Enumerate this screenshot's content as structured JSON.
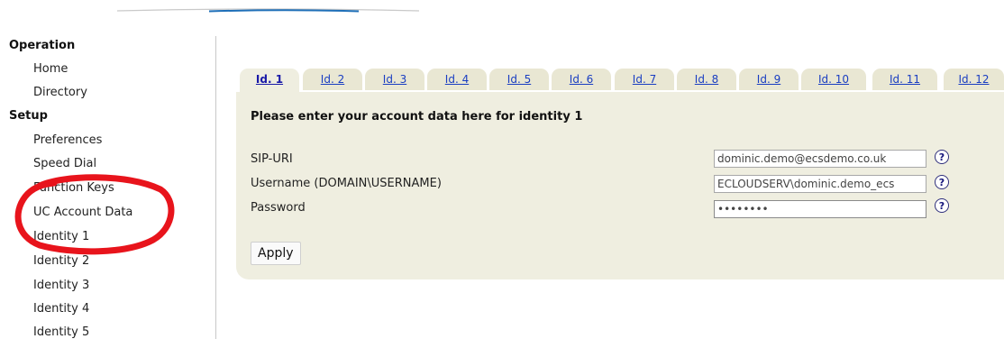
{
  "sidebar": {
    "sections": [
      {
        "heading": "Operation",
        "items": [
          "Home",
          "Directory"
        ]
      },
      {
        "heading": "Setup",
        "items": [
          "Preferences",
          "Speed Dial",
          "Function Keys",
          "UC Account Data",
          "Identity 1",
          "Identity 2",
          "Identity 3",
          "Identity 4",
          "Identity 5"
        ]
      }
    ]
  },
  "tabs": [
    "Id. 1",
    "Id. 2",
    "Id. 3",
    "Id. 4",
    "Id. 5",
    "Id. 6",
    "Id. 7",
    "Id. 8",
    "Id. 9",
    "Id. 10",
    "Id. 11",
    "Id. 12"
  ],
  "active_tab": "Id. 1",
  "form": {
    "title": "Please enter your account data here for identity 1",
    "fields": [
      {
        "label": "SIP-URI",
        "value": "dominic.demo@ecsdemo.co.uk"
      },
      {
        "label": "Username (DOMAIN\\USERNAME)",
        "value": "ECLOUDSERV\\dominic.demo_ecs"
      },
      {
        "label": "Password",
        "value": "••••••••"
      }
    ],
    "help_glyph": "?",
    "apply_label": "Apply"
  },
  "colors": {
    "panel": "#efeee0",
    "tab": "#e9e7d3",
    "link": "#1a3ec2",
    "annotation": "#e8141c"
  },
  "icons": {
    "help": "question-mark-circle-icon",
    "annotation": "red-hand-drawn-circle"
  }
}
